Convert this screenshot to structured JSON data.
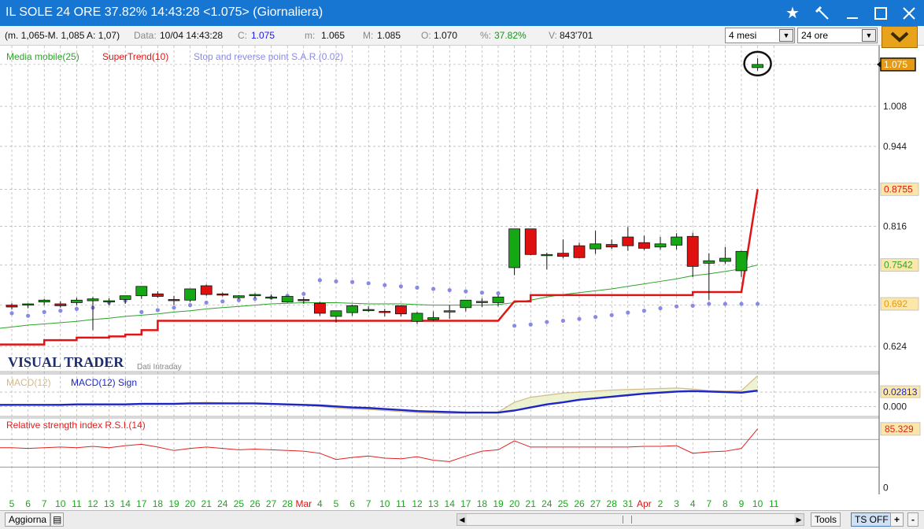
{
  "window": {
    "title": "IL SOLE 24 ORE 37.82% 14:43:28  <1.075> (Giornaliera)",
    "icons": [
      "star-icon",
      "hammer-icon",
      "minimize-icon",
      "maximize-icon",
      "close-icon"
    ]
  },
  "infobar": {
    "range": "(m. 1,065-M. 1,085 A: 1,07)",
    "data_label": "Data:",
    "data_value": "10/04 14:43:28",
    "c_label": "C:",
    "c_value": "1.075",
    "m_label": "m:",
    "m_value": "1.065",
    "mx_label": "M:",
    "mx_value": "1.085",
    "o_label": "O:",
    "o_value": "1.070",
    "pct_label": "%:",
    "pct_value": "37.82%",
    "v_label": "V:",
    "v_value": "843'701",
    "period_select": "4 mesi",
    "interval_select": "24 ore"
  },
  "colors": {
    "up": "#14a814",
    "down": "#e01010",
    "ma": "#2aa52a",
    "supertrend": "#e01414",
    "sar": "#8a8ae6",
    "macd": "#d4b98a",
    "signal": "#1c26c8",
    "rsi": "#e02020",
    "last_price_bg": "#e49a12",
    "grid": "#a0a0a0"
  },
  "chart_data": [
    {
      "type": "candlestick",
      "legend": [
        "Media mobile(25)",
        "SuperTrend(10)",
        "Stop and reverse point S.A.R.(0.02)"
      ],
      "watermark": "VISUAL TRADER",
      "sub_watermark": "Dati Intraday",
      "ylim": [
        0.585,
        1.095
      ],
      "y_ticks": [
        0.624,
        0.69,
        0.754,
        0.816,
        0.875,
        0.944,
        1.008,
        1.075
      ],
      "y_tick_labels": [
        "0.624",
        "",
        "",
        "0.816",
        "",
        "0.944",
        "1.008",
        ""
      ],
      "price_tags": [
        {
          "value": 1.075,
          "label": "1.075",
          "kind": "last"
        },
        {
          "value": 0.8755,
          "label": "0.8755",
          "kind": "supertrend"
        },
        {
          "value": 0.7542,
          "label": "0.7542",
          "kind": "ma"
        },
        {
          "value": 0.692,
          "label": "0.692",
          "kind": "sar"
        }
      ],
      "x_labels": [
        "5",
        "6",
        "7",
        "10",
        "11",
        "12",
        "13",
        "14",
        "17",
        "18",
        "19",
        "20",
        "21",
        "24",
        "25",
        "26",
        "27",
        "28",
        "Mar",
        "4",
        "5",
        "6",
        "7",
        "10",
        "11",
        "12",
        "13",
        "14",
        "17",
        "18",
        "19",
        "20",
        "21",
        "24",
        "25",
        "26",
        "27",
        "28",
        "31",
        "Apr",
        "2",
        "3",
        "4",
        "7",
        "8",
        "9",
        "10",
        "11"
      ],
      "x_label_colors": [
        "g",
        "g",
        "g",
        "g",
        "g",
        "g",
        "g",
        "g",
        "g",
        "g",
        "g",
        "g",
        "g",
        "g",
        "g",
        "g",
        "g",
        "g",
        "r",
        "g",
        "g",
        "g",
        "g",
        "g",
        "g",
        "g",
        "g",
        "g",
        "g",
        "g",
        "g",
        "g",
        "g",
        "g",
        "g",
        "g",
        "g",
        "g",
        "g",
        "r",
        "g",
        "g",
        "g",
        "g",
        "g",
        "g",
        "g",
        "g"
      ],
      "candles": [
        {
          "o": 0.69,
          "h": 0.693,
          "l": 0.683,
          "c": 0.687
        },
        {
          "o": 0.69,
          "h": 0.693,
          "l": 0.685,
          "c": 0.692
        },
        {
          "o": 0.695,
          "h": 0.7,
          "l": 0.69,
          "c": 0.698
        },
        {
          "o": 0.692,
          "h": 0.696,
          "l": 0.686,
          "c": 0.689
        },
        {
          "o": 0.694,
          "h": 0.702,
          "l": 0.69,
          "c": 0.698
        },
        {
          "o": 0.697,
          "h": 0.703,
          "l": 0.65,
          "c": 0.7
        },
        {
          "o": 0.697,
          "h": 0.701,
          "l": 0.69,
          "c": 0.697
        },
        {
          "o": 0.699,
          "h": 0.704,
          "l": 0.692,
          "c": 0.705
        },
        {
          "o": 0.705,
          "h": 0.716,
          "l": 0.7,
          "c": 0.72
        },
        {
          "o": 0.708,
          "h": 0.712,
          "l": 0.702,
          "c": 0.704
        },
        {
          "o": 0.699,
          "h": 0.705,
          "l": 0.69,
          "c": 0.698
        },
        {
          "o": 0.698,
          "h": 0.716,
          "l": 0.695,
          "c": 0.716
        },
        {
          "o": 0.721,
          "h": 0.723,
          "l": 0.705,
          "c": 0.707
        },
        {
          "o": 0.708,
          "h": 0.71,
          "l": 0.704,
          "c": 0.706
        },
        {
          "o": 0.702,
          "h": 0.706,
          "l": 0.7,
          "c": 0.705
        },
        {
          "o": 0.705,
          "h": 0.709,
          "l": 0.701,
          "c": 0.707
        },
        {
          "o": 0.703,
          "h": 0.707,
          "l": 0.699,
          "c": 0.703
        },
        {
          "o": 0.695,
          "h": 0.705,
          "l": 0.694,
          "c": 0.704
        },
        {
          "o": 0.699,
          "h": 0.703,
          "l": 0.692,
          "c": 0.697
        },
        {
          "o": 0.693,
          "h": 0.695,
          "l": 0.673,
          "c": 0.677
        },
        {
          "o": 0.672,
          "h": 0.678,
          "l": 0.662,
          "c": 0.681
        },
        {
          "o": 0.678,
          "h": 0.691,
          "l": 0.673,
          "c": 0.689
        },
        {
          "o": 0.683,
          "h": 0.688,
          "l": 0.679,
          "c": 0.683
        },
        {
          "o": 0.68,
          "h": 0.684,
          "l": 0.672,
          "c": 0.679
        },
        {
          "o": 0.689,
          "h": 0.69,
          "l": 0.672,
          "c": 0.676
        },
        {
          "o": 0.664,
          "h": 0.679,
          "l": 0.66,
          "c": 0.677
        },
        {
          "o": 0.667,
          "h": 0.68,
          "l": 0.665,
          "c": 0.67
        },
        {
          "o": 0.679,
          "h": 0.69,
          "l": 0.668,
          "c": 0.681
        },
        {
          "o": 0.686,
          "h": 0.697,
          "l": 0.68,
          "c": 0.698
        },
        {
          "o": 0.694,
          "h": 0.701,
          "l": 0.687,
          "c": 0.696
        },
        {
          "o": 0.694,
          "h": 0.706,
          "l": 0.688,
          "c": 0.703
        },
        {
          "o": 0.75,
          "h": 0.812,
          "l": 0.738,
          "c": 0.812
        },
        {
          "o": 0.812,
          "h": 0.812,
          "l": 0.77,
          "c": 0.771
        },
        {
          "o": 0.771,
          "h": 0.774,
          "l": 0.747,
          "c": 0.771
        },
        {
          "o": 0.773,
          "h": 0.795,
          "l": 0.765,
          "c": 0.768
        },
        {
          "o": 0.785,
          "h": 0.79,
          "l": 0.765,
          "c": 0.766
        },
        {
          "o": 0.78,
          "h": 0.809,
          "l": 0.772,
          "c": 0.788
        },
        {
          "o": 0.787,
          "h": 0.795,
          "l": 0.78,
          "c": 0.783
        },
        {
          "o": 0.799,
          "h": 0.815,
          "l": 0.777,
          "c": 0.785
        },
        {
          "o": 0.79,
          "h": 0.801,
          "l": 0.778,
          "c": 0.781
        },
        {
          "o": 0.783,
          "h": 0.799,
          "l": 0.779,
          "c": 0.788
        },
        {
          "o": 0.786,
          "h": 0.805,
          "l": 0.779,
          "c": 0.799
        },
        {
          "o": 0.8,
          "h": 0.806,
          "l": 0.735,
          "c": 0.752
        },
        {
          "o": 0.757,
          "h": 0.773,
          "l": 0.698,
          "c": 0.761
        },
        {
          "o": 0.76,
          "h": 0.783,
          "l": 0.756,
          "c": 0.765
        },
        {
          "o": 0.745,
          "h": 0.777,
          "l": 0.735,
          "c": 0.776
        },
        {
          "o": 1.07,
          "h": 1.085,
          "l": 1.065,
          "c": 1.075
        }
      ],
      "ma": [
        0.655,
        0.658,
        0.66,
        0.662,
        0.664,
        0.667,
        0.669,
        0.672,
        0.674,
        0.676,
        0.679,
        0.681,
        0.684,
        0.686,
        0.688,
        0.69,
        0.692,
        0.693,
        0.694,
        0.694,
        0.694,
        0.693,
        0.692,
        0.692,
        0.692,
        0.691,
        0.69,
        0.69,
        0.69,
        0.69,
        0.691,
        0.694,
        0.698,
        0.703,
        0.707,
        0.71,
        0.713,
        0.716,
        0.72,
        0.724,
        0.728,
        0.732,
        0.737,
        0.74,
        0.744,
        0.748,
        0.7542
      ],
      "supertrend": [
        0.627,
        0.627,
        0.634,
        0.634,
        0.638,
        0.638,
        0.64,
        0.643,
        0.65,
        0.665,
        0.665,
        0.665,
        0.665,
        0.665,
        0.665,
        0.665,
        0.665,
        0.665,
        0.665,
        0.665,
        0.665,
        0.665,
        0.665,
        0.665,
        0.665,
        0.665,
        0.665,
        0.665,
        0.665,
        0.665,
        0.665,
        0.696,
        0.706,
        0.706,
        0.706,
        0.706,
        0.706,
        0.706,
        0.706,
        0.706,
        0.706,
        0.706,
        0.711,
        0.711,
        0.711,
        0.711,
        0.8755
      ],
      "sar": [
        0.677,
        0.673,
        0.679,
        0.681,
        0.684,
        0.686,
        0.694,
        0.697,
        0.679,
        0.682,
        0.686,
        0.69,
        0.694,
        0.696,
        0.698,
        0.7,
        0.702,
        0.705,
        0.708,
        0.73,
        0.728,
        0.727,
        0.725,
        0.722,
        0.72,
        0.718,
        0.716,
        0.714,
        0.712,
        0.71,
        0.709,
        0.657,
        0.659,
        0.663,
        0.665,
        0.668,
        0.671,
        0.674,
        0.678,
        0.681,
        0.685,
        0.688,
        0.689,
        0.692,
        0.692,
        0.692,
        0.692
      ],
      "circle_marker_on_last": true
    },
    {
      "type": "line",
      "legend": [
        "MACD(12)",
        "MACD(12) Sign"
      ],
      "ylim": [
        -0.018,
        0.062
      ],
      "y_tick_labels_shown": [
        "0.028",
        "0.000"
      ],
      "last_label": "0.02813",
      "zero_label": "0.000",
      "macd": [
        0.002,
        0.003,
        0.003,
        0.004,
        0.004,
        0.004,
        0.004,
        0.005,
        0.006,
        0.006,
        0.006,
        0.007,
        0.008,
        0.007,
        0.006,
        0.005,
        0.004,
        0.003,
        0.002,
        0.0,
        -0.003,
        -0.005,
        -0.006,
        -0.008,
        -0.01,
        -0.012,
        -0.013,
        -0.014,
        -0.013,
        -0.012,
        -0.011,
        0.008,
        0.018,
        0.022,
        0.026,
        0.028,
        0.03,
        0.032,
        0.033,
        0.034,
        0.035,
        0.036,
        0.034,
        0.031,
        0.03,
        0.031,
        0.06
      ],
      "signal": [
        0.003,
        0.003,
        0.003,
        0.003,
        0.004,
        0.004,
        0.004,
        0.004,
        0.005,
        0.005,
        0.005,
        0.006,
        0.006,
        0.006,
        0.006,
        0.006,
        0.005,
        0.004,
        0.003,
        0.002,
        0.0,
        -0.002,
        -0.003,
        -0.005,
        -0.007,
        -0.009,
        -0.01,
        -0.011,
        -0.012,
        -0.012,
        -0.012,
        -0.008,
        -0.002,
        0.004,
        0.008,
        0.013,
        0.016,
        0.019,
        0.022,
        0.025,
        0.027,
        0.029,
        0.03,
        0.029,
        0.028,
        0.027,
        0.031
      ]
    },
    {
      "type": "line",
      "legend": [
        "Relative strength index R.S.I.(14)"
      ],
      "ylim": [
        -5,
        100
      ],
      "y_tick_labels_shown": [
        "0"
      ],
      "last_label": "85.329",
      "levels": [
        70,
        30
      ],
      "rsi": [
        58,
        57,
        58,
        59,
        58,
        60,
        58,
        61,
        63,
        59,
        54,
        57,
        59,
        57,
        55,
        56,
        55,
        54,
        53,
        50,
        41,
        44,
        46,
        43,
        42,
        45,
        40,
        38,
        46,
        53,
        55,
        68,
        59,
        59,
        59,
        59,
        59,
        59,
        59,
        60,
        60,
        61,
        50,
        52,
        53,
        57,
        85.329
      ]
    }
  ],
  "bottom": {
    "refresh_button": "Aggiorna",
    "tools_button": "Tools",
    "ts_button": "TS OFF",
    "plus_button": "+",
    "minus_button": "-"
  }
}
